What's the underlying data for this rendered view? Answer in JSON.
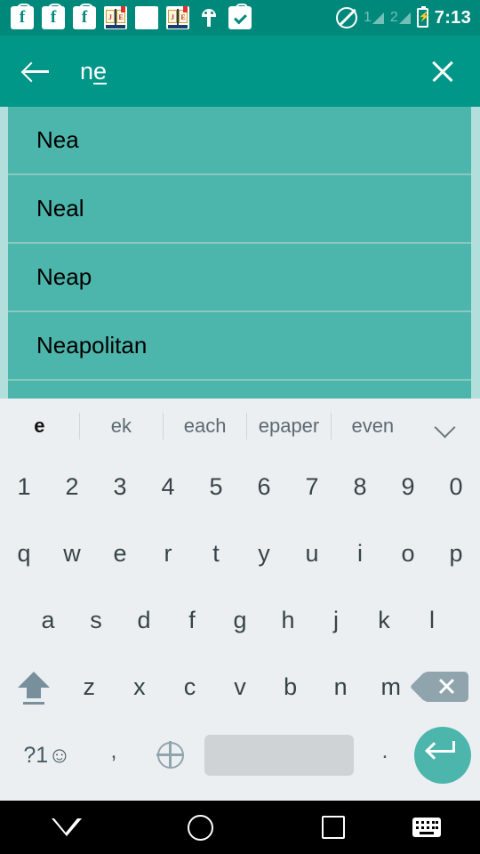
{
  "statusbar": {
    "notifications": [
      {
        "name": "facebook-notification-icon",
        "label": "f"
      },
      {
        "name": "facebook-notification-icon",
        "label": "f"
      },
      {
        "name": "facebook-notification-icon",
        "label": "f"
      },
      {
        "name": "dictionary-book-icon",
        "page_left": "J",
        "page_right": "E"
      },
      {
        "name": "white-square-notification-icon",
        "label": ""
      },
      {
        "name": "dictionary-book-icon",
        "page_left": "J",
        "page_right": "E"
      },
      {
        "name": "android-robot-icon",
        "label": ""
      },
      {
        "name": "clipboard-check-icon",
        "label": ""
      }
    ],
    "dnd_icon": "do-not-disturb-icon",
    "sim1_label": "1",
    "sim2_label": "2",
    "battery_icon": "battery-charging-icon",
    "time": "7:13"
  },
  "toolbar": {
    "back_icon": "back-arrow-icon",
    "query_committed": "n",
    "query_composing": "e",
    "query_full": "ne",
    "clear_icon": "close-icon",
    "accent_color": "#009688"
  },
  "suggestions": {
    "background_color": "#b2dfdb",
    "item_color": "#4db6ac",
    "items": [
      {
        "word": "Nea"
      },
      {
        "word": "Neal"
      },
      {
        "word": "Neap"
      },
      {
        "word": "Neapolitan"
      },
      {
        "word": ""
      }
    ]
  },
  "keyboard": {
    "suggestion_strip": {
      "words": [
        "e",
        "ek",
        "each",
        "epaper",
        "even"
      ],
      "expand_icon": "chevron-down-icon"
    },
    "row_numbers": [
      "1",
      "2",
      "3",
      "4",
      "5",
      "6",
      "7",
      "8",
      "9",
      "0"
    ],
    "row_top": [
      "q",
      "w",
      "e",
      "r",
      "t",
      "y",
      "u",
      "i",
      "o",
      "p"
    ],
    "row_home": [
      "a",
      "s",
      "d",
      "f",
      "g",
      "h",
      "j",
      "k",
      "l"
    ],
    "row_bottom": [
      "z",
      "x",
      "c",
      "v",
      "b",
      "n",
      "m"
    ],
    "shift_icon": "shift-key-icon",
    "backspace_icon": "backspace-key-icon",
    "symbols_label": "?1☺",
    "comma_label": ",",
    "globe_icon": "language-globe-icon",
    "space_label": "",
    "period_label": ".",
    "enter_icon": "enter-key-icon",
    "enter_color": "#4db6ac"
  },
  "navbar": {
    "back_icon": "back-triangle-icon",
    "home_icon": "home-circle-icon",
    "recents_icon": "recents-square-icon",
    "keyboard_switcher_icon": "keyboard-switcher-icon"
  }
}
